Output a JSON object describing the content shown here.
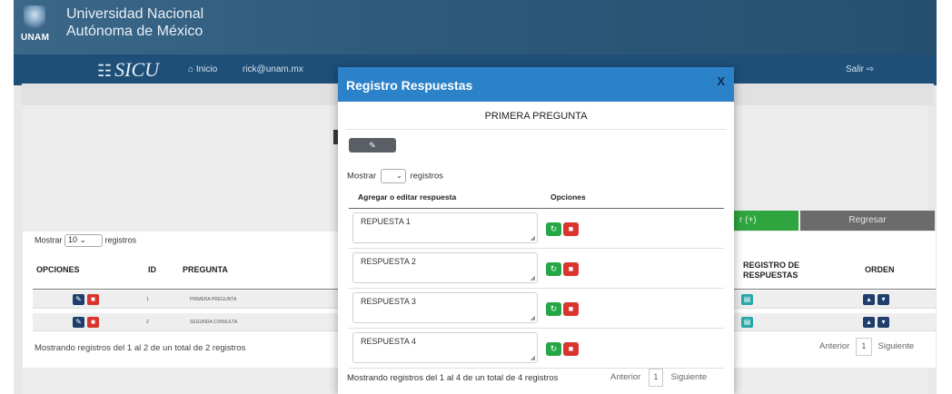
{
  "header": {
    "institution_line1": "Universidad Nacional",
    "institution_line2": "Autónoma de México",
    "logo_text": "UNAM"
  },
  "navbar": {
    "brand": "SICU",
    "brand_icon": "sicu-logo-icon",
    "home_label": "Inicio",
    "home_icon": "home-icon",
    "user_email": "rick@unam.mx",
    "logout_label": "Salir",
    "logout_icon": "logout-icon"
  },
  "background_page": {
    "add_button": "r (+)",
    "back_button": "Regresar",
    "show_label_prefix": "Mostrar",
    "show_value": "10",
    "show_label_suffix": "registros",
    "columns": [
      "OPCIONES",
      "ID",
      "PREGUNTA",
      "REGISTRO DE RESPUESTAS",
      "ORDEN"
    ],
    "rows": [
      {
        "id": "1",
        "pregunta": "PRIMERA PREGUNTA"
      },
      {
        "id": "2",
        "pregunta": "SEGUNDA CONSULTA"
      }
    ],
    "footer": "Mostrando registros del 1 al 2 de un total de 2 registros",
    "pager": {
      "prev": "Anterior",
      "page": "1",
      "next": "Siguiente"
    }
  },
  "modal": {
    "title": "Registro Respuestas",
    "close": "X",
    "subtitle": "PRIMERA PREGUNTA",
    "edit_icon": "pencil-icon",
    "show_label_prefix": "Mostrar",
    "show_label_suffix": "registros",
    "columns": {
      "answer": "Agregar o editar respuesta",
      "options": "Opciones"
    },
    "answers": [
      "REPUESTA 1",
      "RESPUESTA 2",
      "RESPUESTA 3",
      "RESPUESTA 4"
    ],
    "footer": "Mostrando registros del 1 al 4 de un total de 4 registros",
    "pager": {
      "prev": "Anterior",
      "page": "1",
      "next": "Siguiente"
    }
  },
  "colors": {
    "header_blue": "#2e5a7c",
    "navbar_blue": "#1e4f78",
    "modal_header": "#2c82c9",
    "refresh_green": "#27a646",
    "delete_red": "#d9352f"
  }
}
